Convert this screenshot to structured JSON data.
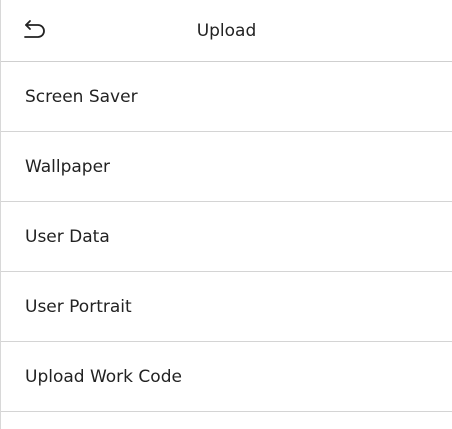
{
  "header": {
    "title": "Upload",
    "back_icon": "back-arrow-icon"
  },
  "menu": {
    "items": [
      {
        "label": "Screen Saver"
      },
      {
        "label": "Wallpaper"
      },
      {
        "label": "User Data"
      },
      {
        "label": "User Portrait"
      },
      {
        "label": "Upload Work Code"
      }
    ]
  }
}
